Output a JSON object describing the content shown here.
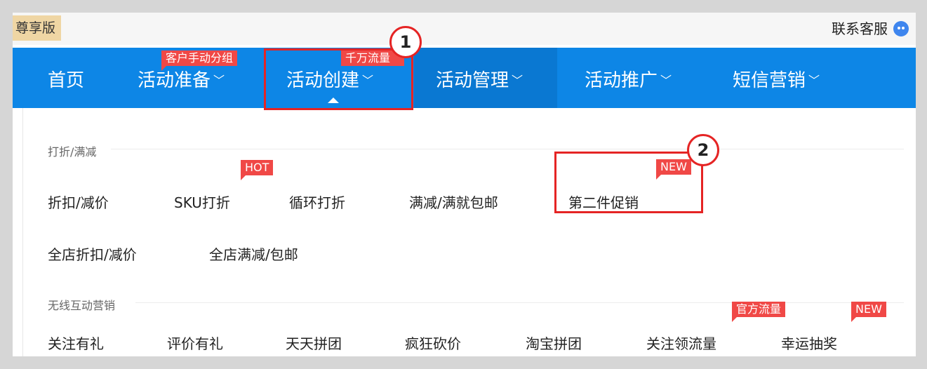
{
  "topbar": {
    "edition": "尊享版",
    "contact": "联系客服",
    "contact_icon": "chat-bubble-icon"
  },
  "nav": {
    "items": [
      {
        "label": "首页",
        "chevron": ""
      },
      {
        "label": "活动准备",
        "chevron": "﹀",
        "tag": "客户手动分组"
      },
      {
        "label": "活动创建",
        "chevron": "﹀",
        "tag": "千万流量"
      },
      {
        "label": "活动管理",
        "chevron": "﹀"
      },
      {
        "label": "活动推广",
        "chevron": "﹀"
      },
      {
        "label": "短信营销",
        "chevron": "﹀"
      }
    ]
  },
  "annotations": {
    "step1": "1",
    "step2": "2"
  },
  "dropdown": {
    "discount_section": {
      "title": "打折/满减",
      "row1": [
        {
          "label": "折扣/减价"
        },
        {
          "label": "SKU打折",
          "tag": "HOT"
        },
        {
          "label": "循环打折"
        },
        {
          "label": "满减/满就包邮"
        },
        {
          "label": "第二件促销",
          "tag": "NEW"
        }
      ],
      "row2": [
        {
          "label": "全店折扣/减价"
        },
        {
          "label": "全店满减/包邮"
        }
      ]
    },
    "wireless_section": {
      "title": "无线互动营销",
      "row1": [
        {
          "label": "关注有礼"
        },
        {
          "label": "评价有礼"
        },
        {
          "label": "天天拼团"
        },
        {
          "label": "疯狂砍价"
        },
        {
          "label": "淘宝拼团"
        },
        {
          "label": "关注领流量",
          "tag": "官方流量"
        },
        {
          "label": "幸运抽奖",
          "tag": "NEW"
        }
      ]
    }
  },
  "colors": {
    "nav_bg": "#0d86e6",
    "tag_red": "#f04846",
    "highlight_red": "#e52424",
    "edition_bg": "#efd6a4"
  }
}
